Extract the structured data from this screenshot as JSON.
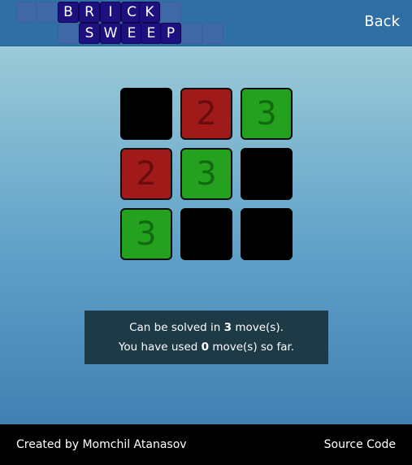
{
  "header": {
    "logo_row1": [
      "B",
      "R",
      "I",
      "C",
      "K"
    ],
    "logo_row2": [
      "S",
      "W",
      "E",
      "E",
      "P"
    ],
    "back_label": "Back",
    "colors": {
      "bar": "#2f6fa3",
      "tile": "#1e107e",
      "ghost_tile": "#3f68a6"
    }
  },
  "board": {
    "rows": 3,
    "cols": 3,
    "cells": [
      {
        "color": "black",
        "value": ""
      },
      {
        "color": "red",
        "value": "2"
      },
      {
        "color": "green",
        "value": "3"
      },
      {
        "color": "red",
        "value": "2"
      },
      {
        "color": "green",
        "value": "3"
      },
      {
        "color": "black",
        "value": ""
      },
      {
        "color": "green",
        "value": "3"
      },
      {
        "color": "black",
        "value": ""
      },
      {
        "color": "black",
        "value": ""
      }
    ],
    "colors": {
      "black": "#000000",
      "red": "#a01a1a",
      "green": "#24a11e"
    }
  },
  "status": {
    "line1_prefix": "Can be solved in ",
    "min_moves": "3",
    "line1_suffix": " move(s).",
    "line2_prefix": "You have used ",
    "used_moves": "0",
    "line2_suffix": " move(s) so far."
  },
  "footer": {
    "credit": "Created by Momchil Atanasov",
    "source_label": "Source Code"
  }
}
